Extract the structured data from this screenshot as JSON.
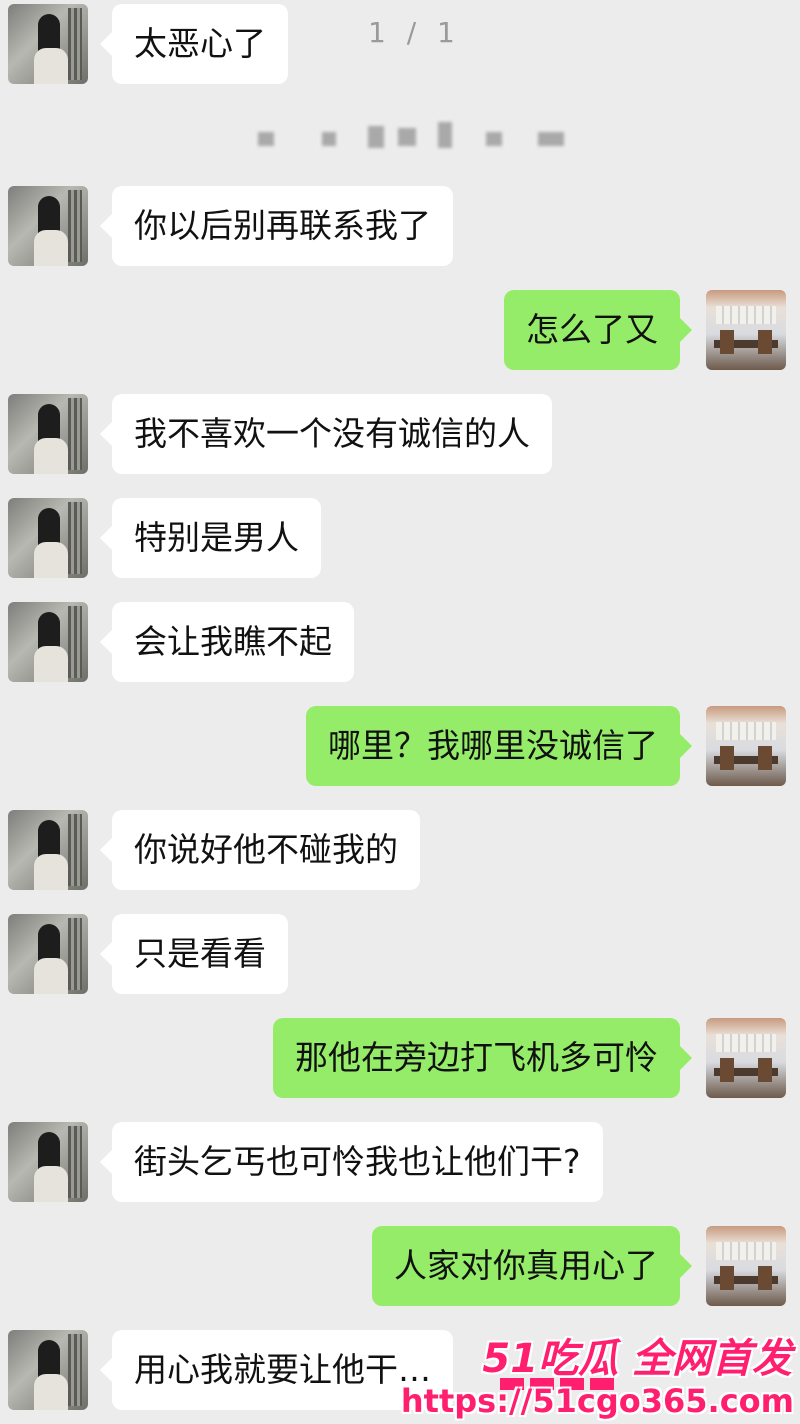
{
  "chat": {
    "page_indicator": "1 / 1",
    "messages": [
      {
        "side": "left",
        "text": "太恶心了"
      },
      {
        "side": "left",
        "text": "你以后别再联系我了"
      },
      {
        "side": "right",
        "text": "怎么了又"
      },
      {
        "side": "left",
        "text": "我不喜欢一个没有诚信的人"
      },
      {
        "side": "left",
        "text": "特别是男人"
      },
      {
        "side": "left",
        "text": "会让我瞧不起"
      },
      {
        "side": "right",
        "text": "哪里？我哪里没诚信了"
      },
      {
        "side": "left",
        "text": "你说好他不碰我的"
      },
      {
        "side": "left",
        "text": "只是看看"
      },
      {
        "side": "right",
        "text": "那他在旁边打飞机多可怜"
      },
      {
        "side": "left",
        "text": "街头乞丐也可怜我也让他们干?"
      },
      {
        "side": "right",
        "text": "人家对你真用心了"
      },
      {
        "side": "left",
        "text": "用心我就要让他干…"
      }
    ]
  },
  "watermark": {
    "brand": "51吃瓜 全网首发",
    "url": "https://51cgo365.com",
    "color": "#ff1f6e"
  },
  "colors": {
    "background": "#ececec",
    "incoming_bubble": "#ffffff",
    "outgoing_bubble": "#95ec69"
  }
}
